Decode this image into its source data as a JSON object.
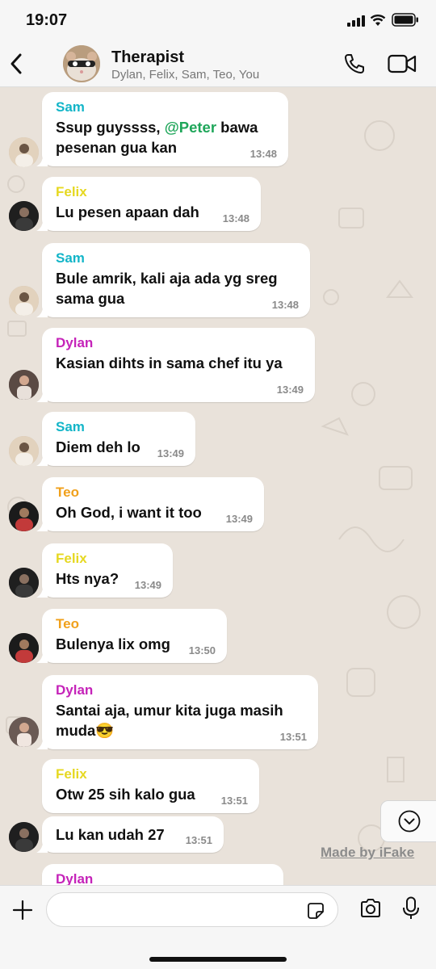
{
  "status_bar": {
    "time": "19:07"
  },
  "header": {
    "title": "Therapist",
    "members": "Dylan, Felix, Sam, Teo, You"
  },
  "colors": {
    "sam": "#13b5c8",
    "felix": "#e6d821",
    "dylan": "#c523b9",
    "teo": "#f0a01b",
    "mention": "#1fa65a"
  },
  "messages": [
    {
      "sender": "Sam",
      "before": "Ssup guyssss, ",
      "mention": "@Peter",
      "after": " bawa pesenan gua kan",
      "time": "13:48"
    },
    {
      "sender": "Felix",
      "text": "Lu pesen apaan dah",
      "time": "13:48"
    },
    {
      "sender": "Sam",
      "text": "Bule amrik, kali aja ada yg sreg sama gua",
      "time": "13:48"
    },
    {
      "sender": "Dylan",
      "text": "Kasian dihts in sama chef itu ya",
      "time": "13:49"
    },
    {
      "sender": "Sam",
      "text": "Diem deh lo",
      "time": "13:49"
    },
    {
      "sender": "Teo",
      "text": "Oh God, i want it too",
      "time": "13:49"
    },
    {
      "sender": "Felix",
      "text": "Hts nya?",
      "time": "13:49"
    },
    {
      "sender": "Teo",
      "text": "Bulenya lix omg",
      "time": "13:50"
    },
    {
      "sender": "Dylan",
      "text": "Santai aja, umur kita juga masih muda😎",
      "time": "13:51"
    },
    {
      "sender": "Felix",
      "text": "Otw 25 sih kalo gua",
      "time": "13:51"
    },
    {
      "sender": "",
      "text": "Lu kan udah 27",
      "time": "13:51"
    },
    {
      "sender": "Dylan",
      "text": "",
      "time": ""
    }
  ],
  "watermark": "Made by iFake",
  "composer": {
    "placeholder": ""
  }
}
